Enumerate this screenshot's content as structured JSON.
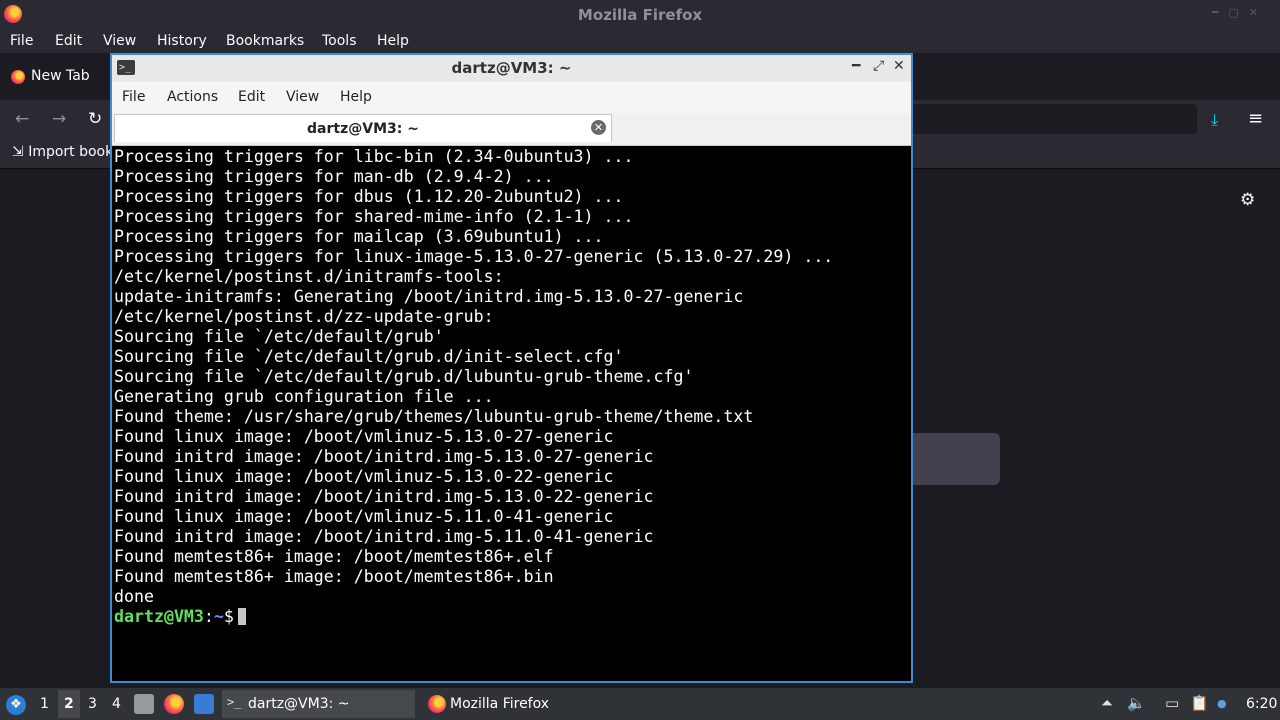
{
  "firefox": {
    "window_title": "Mozilla Firefox",
    "menu": [
      "File",
      "Edit",
      "View",
      "History",
      "Bookmarks",
      "Tools",
      "Help"
    ],
    "tab_label": "New Tab",
    "bookmarks_import": "Import book"
  },
  "terminal": {
    "title": "dartz@VM3: ~",
    "menu": [
      "File",
      "Actions",
      "Edit",
      "View",
      "Help"
    ],
    "tab_label": "dartz@VM3: ~",
    "lines": [
      "Processing triggers for libc-bin (2.34-0ubuntu3) ...",
      "Processing triggers for man-db (2.9.4-2) ...",
      "Processing triggers for dbus (1.12.20-2ubuntu2) ...",
      "Processing triggers for shared-mime-info (2.1-1) ...",
      "Processing triggers for mailcap (3.69ubuntu1) ...",
      "Processing triggers for linux-image-5.13.0-27-generic (5.13.0-27.29) ...",
      "/etc/kernel/postinst.d/initramfs-tools:",
      "update-initramfs: Generating /boot/initrd.img-5.13.0-27-generic",
      "/etc/kernel/postinst.d/zz-update-grub:",
      "Sourcing file `/etc/default/grub'",
      "Sourcing file `/etc/default/grub.d/init-select.cfg'",
      "Sourcing file `/etc/default/grub.d/lubuntu-grub-theme.cfg'",
      "Generating grub configuration file ...",
      "Found theme: /usr/share/grub/themes/lubuntu-grub-theme/theme.txt",
      "Found linux image: /boot/vmlinuz-5.13.0-27-generic",
      "Found initrd image: /boot/initrd.img-5.13.0-27-generic",
      "Found linux image: /boot/vmlinuz-5.13.0-22-generic",
      "Found initrd image: /boot/initrd.img-5.13.0-22-generic",
      "Found linux image: /boot/vmlinuz-5.11.0-41-generic",
      "Found initrd image: /boot/initrd.img-5.11.0-41-generic",
      "Found memtest86+ image: /boot/memtest86+.elf",
      "Found memtest86+ image: /boot/memtest86+.bin",
      "done"
    ],
    "prompt_user": "dartz@VM3",
    "prompt_sep": ":",
    "prompt_path": "~",
    "prompt_symbol": "$"
  },
  "taskbar": {
    "workspaces": [
      "1",
      "2",
      "3",
      "4"
    ],
    "active_workspace": "2",
    "tasks": [
      {
        "label": "dartz@VM3: ~",
        "icon": "terminal-icon",
        "active": true
      },
      {
        "label": "Mozilla Firefox",
        "icon": "firefox-icon",
        "active": false
      }
    ],
    "clock": "6:20"
  },
  "colors": {
    "terminal_border": "#3d8bd9",
    "prompt_user": "#5fe35f",
    "prompt_path": "#6a8cff",
    "firefox_accent": "#00ddff"
  }
}
